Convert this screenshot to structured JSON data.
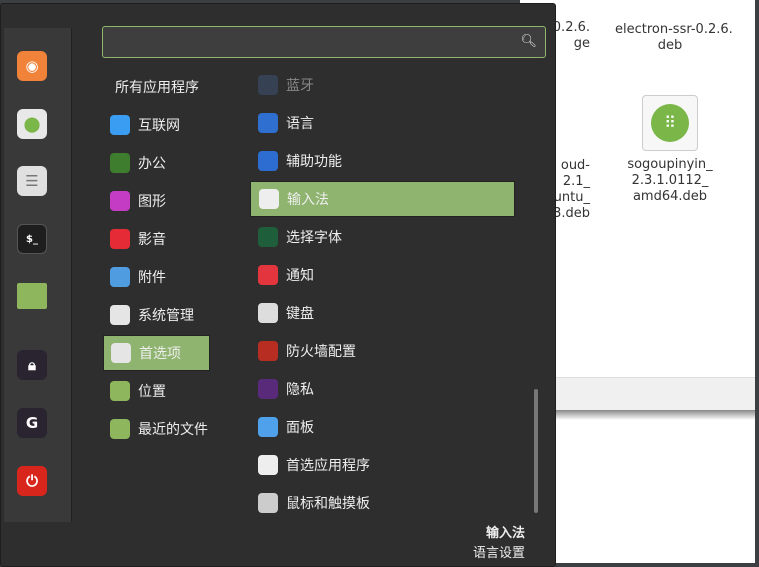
{
  "file_manager": {
    "items": [
      {
        "name": "-0.2.6.\nge"
      },
      {
        "name": "electron-ssr-0.2.6.\ndeb"
      },
      {
        "name": "oud-\n2.1_\nuntu_\n3.deb"
      },
      {
        "name": "sogoupinyin_\n2.3.1.0112_\namd64.deb"
      }
    ]
  },
  "search": {
    "value": "",
    "placeholder": ""
  },
  "favorites": [
    {
      "name": "firefox",
      "color": "#f0823a"
    },
    {
      "name": "software-manager",
      "color": "#e8e8e8"
    },
    {
      "name": "system-settings",
      "color": "#e0e0e0"
    },
    {
      "name": "terminal",
      "color": "#1e1e1e"
    },
    {
      "name": "files",
      "color": "#8db65d"
    },
    {
      "name": "lock-screen",
      "color": "#2a2430"
    },
    {
      "name": "logout",
      "color": "#2a2430"
    },
    {
      "name": "shutdown",
      "color": "#d9261c"
    }
  ],
  "categories": [
    {
      "label": "所有应用程序"
    },
    {
      "label": "互联网",
      "color": "#3a9df2"
    },
    {
      "label": "办公",
      "color": "#3f7d2e"
    },
    {
      "label": "图形",
      "color": "#c43cc4"
    },
    {
      "label": "影音",
      "color": "#e52b35"
    },
    {
      "label": "附件",
      "color": "#4f9de0"
    },
    {
      "label": "系统管理",
      "color": "#e5e5e5"
    },
    {
      "label": "首选项",
      "color": "#e5e5e5",
      "selected": true
    },
    {
      "label": "位置",
      "color": "#8db65d"
    },
    {
      "label": "最近的文件",
      "color": "#8db65d"
    }
  ],
  "apps": [
    {
      "label": "蓝牙",
      "color": "#3c4e6e",
      "dim": true
    },
    {
      "label": "语言",
      "color": "#2f6fcf"
    },
    {
      "label": "辅助功能",
      "color": "#2d6cd1"
    },
    {
      "label": "输入法",
      "color": "#eeeeee",
      "selected": true
    },
    {
      "label": "选择字体",
      "color": "#1e5e3a"
    },
    {
      "label": "通知",
      "color": "#e3353d"
    },
    {
      "label": "键盘",
      "color": "#dddddd"
    },
    {
      "label": "防火墙配置",
      "color": "#b82d22"
    },
    {
      "label": "隐私",
      "color": "#5a2a7a"
    },
    {
      "label": "面板",
      "color": "#4ea1ea"
    },
    {
      "label": "首选应用程序",
      "color": "#eeeeee"
    },
    {
      "label": "鼠标和触摸板",
      "color": "#cccccc"
    }
  ],
  "description": {
    "title": "输入法",
    "subtitle": "语言设置"
  }
}
